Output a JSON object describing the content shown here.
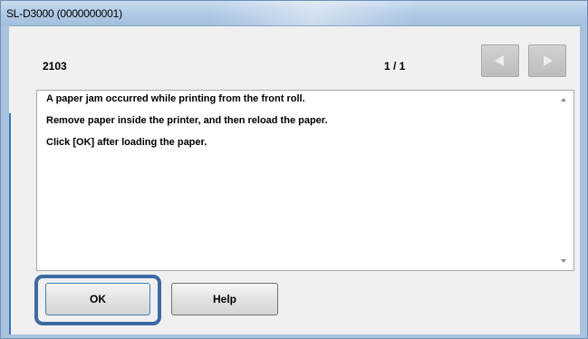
{
  "window": {
    "title": "SL-D3000 (0000000001)"
  },
  "error": {
    "code": "2103",
    "page_indicator": "1 / 1",
    "messages": [
      "A paper jam occurred while printing from the front roll.",
      "Remove paper inside the printer, and then reload the paper.",
      "Click [OK] after loading the paper."
    ]
  },
  "nav": {
    "prev_icon": "arrow-left-icon",
    "next_icon": "arrow-right-icon"
  },
  "buttons": {
    "ok_label": "OK",
    "help_label": "Help"
  },
  "colors": {
    "focus_ring": "#3e6aa3",
    "titlebar": "#b3cbe6"
  }
}
